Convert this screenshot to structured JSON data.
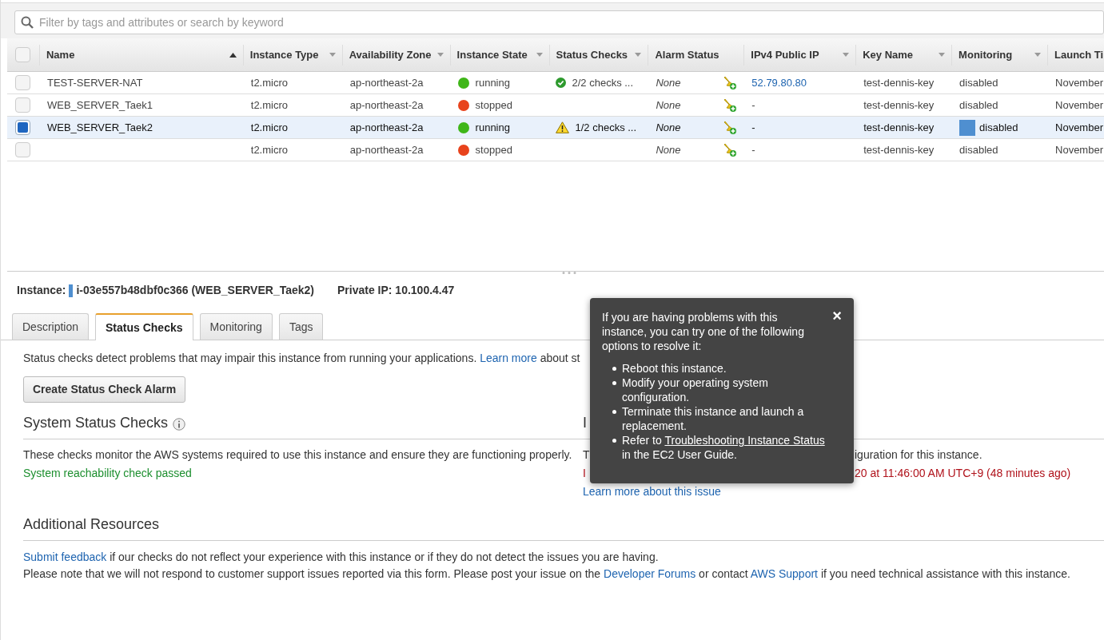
{
  "search": {
    "placeholder": "Filter by tags and attributes or search by keyword"
  },
  "select_all": {
    "checked": false
  },
  "columns": [
    {
      "label": "Name",
      "kind": "sorted"
    },
    {
      "label": "Instance Type",
      "kind": "menu"
    },
    {
      "label": "Availability Zone",
      "kind": "menu"
    },
    {
      "label": "Instance State",
      "kind": "menu"
    },
    {
      "label": "Status Checks",
      "kind": "menu"
    },
    {
      "label": "Alarm Status",
      "kind": "plain"
    },
    {
      "label": "IPv4 Public IP",
      "kind": "menu"
    },
    {
      "label": "Key Name",
      "kind": "menu"
    },
    {
      "label": "Monitoring",
      "kind": "menu"
    },
    {
      "label": "Launch Ti",
      "kind": "plain"
    }
  ],
  "rows": [
    {
      "selected": false,
      "name": "TEST-SERVER-NAT",
      "type": "t2.micro",
      "zone": "ap-northeast-2a",
      "state": {
        "label": "running",
        "color": "#3fb618"
      },
      "checks": {
        "kind": "ok",
        "label": "2/2 checks ..."
      },
      "alarm": "None",
      "ip": {
        "text": "52.79.80.80",
        "link": true
      },
      "key": "test-dennis-key",
      "monitoring": "disabled",
      "launch": "November"
    },
    {
      "selected": false,
      "name": "WEB_SERVER_Taek1",
      "type": "t2.micro",
      "zone": "ap-northeast-2a",
      "state": {
        "label": "stopped",
        "color": "#e8431c"
      },
      "alarm": "None",
      "ip": {
        "text": "-",
        "link": false
      },
      "key": "test-dennis-key",
      "monitoring": "disabled",
      "launch": "November"
    },
    {
      "selected": true,
      "name": "WEB_SERVER_Taek2",
      "type": "t2.micro",
      "zone": "ap-northeast-2a",
      "state": {
        "label": "running",
        "color": "#3fb618"
      },
      "checks": {
        "kind": "warning",
        "label": "1/2 checks ..."
      },
      "alarm": "None",
      "ip": {
        "text": "-",
        "link": false
      },
      "key": "test-dennis-key",
      "monitoring": "disabled",
      "launch": "November"
    },
    {
      "selected": false,
      "type": "t2.micro",
      "zone": "ap-northeast-2a",
      "state": {
        "label": "stopped",
        "color": "#e8431c"
      },
      "alarm": "None",
      "ip": {
        "text": "-",
        "link": false
      },
      "key": "test-dennis-key",
      "monitoring": "disabled",
      "launch": "November"
    }
  ],
  "instance": {
    "label": "Instance:",
    "value": "i-03e557b48dbf0c366 (WEB_SERVER_Taek2)",
    "private_ip": "Private IP: 10.100.4.47"
  },
  "tabs": [
    {
      "label": "Description",
      "selected": false
    },
    {
      "label": "Status Checks",
      "selected": true
    },
    {
      "label": "Monitoring",
      "selected": false
    },
    {
      "label": "Tags",
      "selected": false
    }
  ],
  "intro": {
    "text": "Status checks detect problems that may impair this instance from running your applications.",
    "link": "Learn more",
    "after": "about st"
  },
  "alarm_button": "Create Status Check Alarm",
  "system": {
    "title": "System Status Checks",
    "text": "These checks monitor the AWS systems required to use this instance and ensure they are functioning properly.",
    "result": "System reachability check passed"
  },
  "instance_checks": {
    "title": "I",
    "text_start": "T",
    "text_end": "iguration for this instance.",
    "error_start": "I",
    "error_end": "20 at 11:46:00 AM UTC+9 (48 minutes ago)",
    "link": "Learn more about this issue"
  },
  "resources": {
    "title": "Additional Resources",
    "lines": [
      [
        {
          "text": "Submit feedback",
          "link": true
        },
        {
          "text": "if our checks do not reflect your experience with this instance or if they do not detect the issues you are having.",
          "link": false
        }
      ],
      [
        {
          "text": "Please note that we will not respond to customer support issues reported via this form. Please post your issue on the",
          "link": false
        },
        {
          "text": "Developer Forums",
          "link": true
        },
        {
          "text": "or contact",
          "link": false
        },
        {
          "text": "AWS Support",
          "link": true
        },
        {
          "text": "if you need technical assistance with this instance.",
          "link": false
        }
      ]
    ]
  },
  "popup": {
    "text": "If you are having problems with this instance, you can try one of the following options to resolve it:",
    "close": "×",
    "items": [
      {
        "text": "Reboot this instance."
      },
      {
        "text": "Modify your operating system configuration."
      },
      {
        "text": "Terminate this instance and launch a replacement."
      },
      {
        "text": "Refer to",
        "link": "Troubleshooting Instance Status",
        "after": "in the EC2 User Guide."
      }
    ]
  }
}
